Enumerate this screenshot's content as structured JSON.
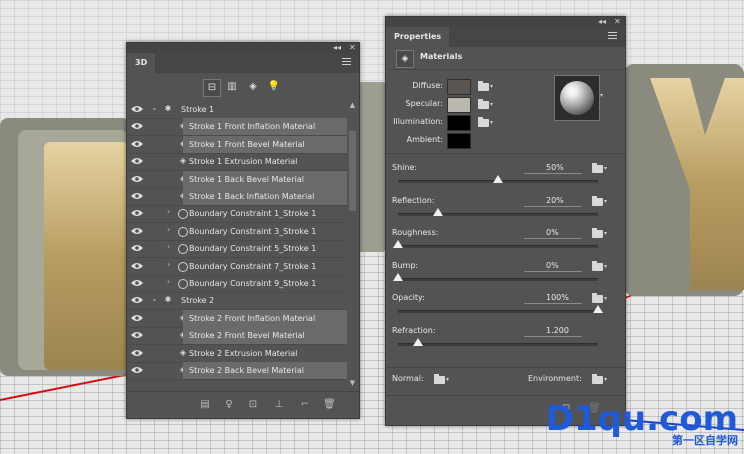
{
  "panel3d": {
    "tab": "3D",
    "filters": [
      "scene-filter",
      "mesh-filter",
      "material-filter",
      "light-filter"
    ],
    "rows": [
      {
        "label": "Stroke 1",
        "type": "group",
        "expanded": true,
        "selected": false
      },
      {
        "label": "Stroke 1 Front Inflation Material",
        "type": "material",
        "selected": true
      },
      {
        "label": "Stroke 1 Front Bevel Material",
        "type": "material",
        "selected": true
      },
      {
        "label": "Stroke 1 Extrusion Material",
        "type": "material",
        "selected": false
      },
      {
        "label": "Stroke 1 Back Bevel Material",
        "type": "material",
        "selected": true
      },
      {
        "label": "Stroke 1 Back Inflation Material",
        "type": "material",
        "selected": true
      },
      {
        "label": "Boundary Constraint 1_Stroke 1",
        "type": "constraint",
        "selected": false
      },
      {
        "label": "Boundary Constraint 3_Stroke 1",
        "type": "constraint",
        "selected": false
      },
      {
        "label": "Boundary Constraint 5_Stroke 1",
        "type": "constraint",
        "selected": false
      },
      {
        "label": "Boundary Constraint 7_Stroke 1",
        "type": "constraint",
        "selected": false
      },
      {
        "label": "Boundary Constraint 9_Stroke 1",
        "type": "constraint",
        "selected": false
      },
      {
        "label": "Stroke 2",
        "type": "group",
        "expanded": true,
        "selected": false
      },
      {
        "label": "Stroke 2 Front Inflation Material",
        "type": "material",
        "selected": true
      },
      {
        "label": "Stroke 2 Front Bevel Material",
        "type": "material",
        "selected": true
      },
      {
        "label": "Stroke 2 Extrusion Material",
        "type": "material",
        "selected": false
      },
      {
        "label": "Stroke 2 Back Bevel Material",
        "type": "material",
        "selected": true
      }
    ]
  },
  "properties": {
    "tab": "Properties",
    "section_title": "Materials",
    "colors": [
      {
        "label": "Diffuse:",
        "color": "#5a5550"
      },
      {
        "label": "Specular:",
        "color": "#b9b7ae"
      },
      {
        "label": "Illumination:",
        "color": "#000000"
      },
      {
        "label": "Ambient:",
        "color": "#000000"
      }
    ],
    "sliders": [
      {
        "label": "Shine:",
        "value": "50%",
        "level": 0.5
      },
      {
        "label": "Reflection:",
        "value": "20%",
        "level": 0.2
      },
      {
        "label": "Roughness:",
        "value": "0%",
        "level": 0.0
      },
      {
        "label": "Bump:",
        "value": "0%",
        "level": 0.0
      },
      {
        "label": "Opacity:",
        "value": "100%",
        "level": 1.0
      },
      {
        "label": "Refraction:",
        "value": "1.200",
        "level": 0.1
      }
    ],
    "normal_label": "Normal:",
    "environment_label": "Environment:"
  },
  "watermark": {
    "text": "D1qu.com",
    "subtext": "第一区自学网"
  }
}
